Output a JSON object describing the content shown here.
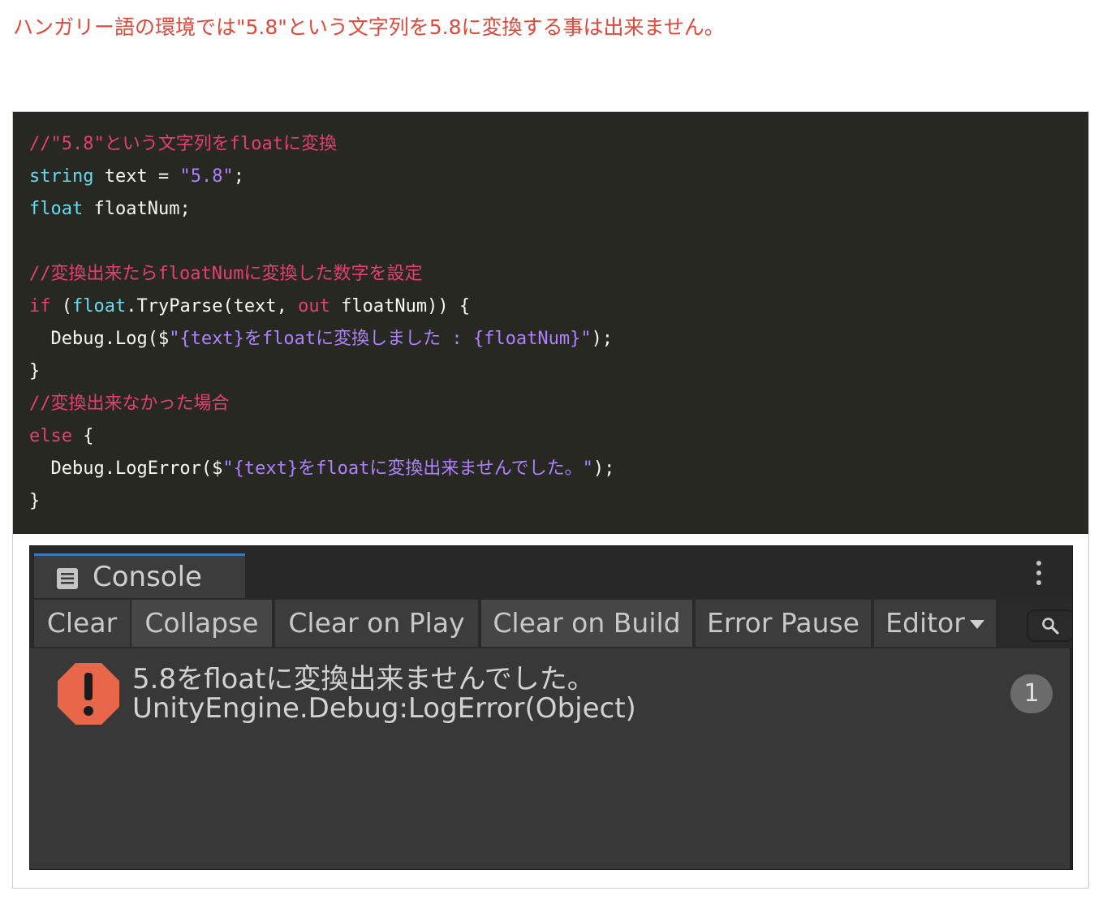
{
  "heading": "ハンガリー語の環境では\"5.8\"という文字列を5.8に変換する事は出来ません。",
  "code": {
    "lines": [
      [
        {
          "cls": "c-comment",
          "t": "//\"5.8\"という文字列をfloatに変換"
        }
      ],
      [
        {
          "cls": "c-type",
          "t": "string"
        },
        {
          "cls": "c-plain",
          "t": " text = "
        },
        {
          "cls": "c-str",
          "t": "\"5.8\""
        },
        {
          "cls": "c-plain",
          "t": ";"
        }
      ],
      [
        {
          "cls": "c-type",
          "t": "float"
        },
        {
          "cls": "c-plain",
          "t": " floatNum;"
        }
      ],
      [],
      [
        {
          "cls": "c-comment",
          "t": "//変換出来たらfloatNumに変換した数字を設定"
        }
      ],
      [
        {
          "cls": "c-kw",
          "t": "if"
        },
        {
          "cls": "c-plain",
          "t": " ("
        },
        {
          "cls": "c-type",
          "t": "float"
        },
        {
          "cls": "c-plain",
          "t": ".TryParse(text, "
        },
        {
          "cls": "c-kw",
          "t": "out"
        },
        {
          "cls": "c-plain",
          "t": " floatNum)) {"
        }
      ],
      [
        {
          "cls": "c-plain",
          "t": "  Debug.Log($"
        },
        {
          "cls": "c-str",
          "t": "\"{text}をfloatに変換しました : {floatNum}\""
        },
        {
          "cls": "c-plain",
          "t": ");"
        }
      ],
      [
        {
          "cls": "c-plain",
          "t": "}"
        }
      ],
      [
        {
          "cls": "c-comment",
          "t": "//変換出来なかった場合"
        }
      ],
      [
        {
          "cls": "c-kw",
          "t": "else"
        },
        {
          "cls": "c-plain",
          "t": " {"
        }
      ],
      [
        {
          "cls": "c-plain",
          "t": "  Debug.LogError($"
        },
        {
          "cls": "c-str",
          "t": "\"{text}をfloatに変換出来ませんでした。\""
        },
        {
          "cls": "c-plain",
          "t": ");"
        }
      ],
      [
        {
          "cls": "c-plain",
          "t": "}"
        }
      ]
    ]
  },
  "console": {
    "tab_label": "Console",
    "tab_icon": "console-list-icon",
    "toolbar": {
      "clear": "Clear",
      "collapse": "Collapse",
      "clear_on_play": "Clear on Play",
      "clear_on_build": "Clear on Build",
      "error_pause": "Error Pause",
      "editor": "Editor"
    },
    "search_icon": "search-icon",
    "log": {
      "message": "5.8をfloatに変換出来ませんでした。",
      "stack": "UnityEngine.Debug:LogError(Object)",
      "count": "1",
      "icon": "error-icon",
      "icon_color": "#e8674a"
    }
  }
}
